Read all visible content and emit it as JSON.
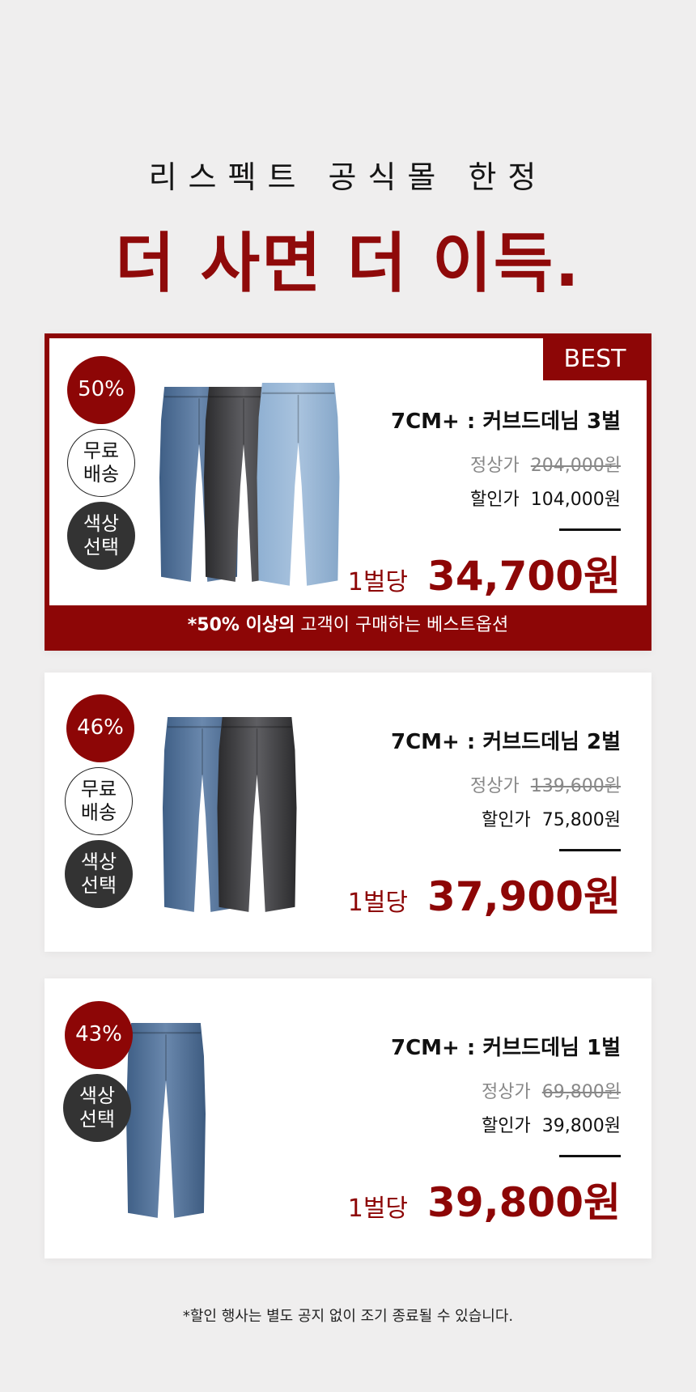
{
  "header": {
    "subtitle": "리스펙트 공식몰 한정",
    "title": "더 사면 더 이득."
  },
  "colors": {
    "accent": "#8d0606",
    "background": "#efeeee"
  },
  "products": [
    {
      "best_tag": "BEST",
      "discount": "50%",
      "free_shipping": "무료 배송",
      "color_select": "색상 선택",
      "name": "7CM+ : 커브드데님 3벌",
      "original_label": "정상가",
      "original_price": "204,000원",
      "sale_label": "할인가",
      "sale_price": "104,000원",
      "per_label": "1벌당",
      "per_price": "34,700원",
      "best_note_bold": "*50% 이상의",
      "best_note_rest": " 고객이 구매하는 베스트옵션"
    },
    {
      "discount": "46%",
      "free_shipping": "무료 배송",
      "color_select": "색상 선택",
      "name": "7CM+ : 커브드데님 2벌",
      "original_label": "정상가",
      "original_price": "139,600원",
      "sale_label": "할인가",
      "sale_price": "75,800원",
      "per_label": "1벌당",
      "per_price": "37,900원"
    },
    {
      "discount": "43%",
      "color_select": "색상 선택",
      "name": "7CM+ : 커브드데님 1벌",
      "original_label": "정상가",
      "original_price": "69,800원",
      "sale_label": "할인가",
      "sale_price": "39,800원",
      "per_label": "1벌당",
      "per_price": "39,800원"
    }
  ],
  "footer_note": "*할인 행사는 별도 공지 없이 조기 종료될 수 있습니다."
}
